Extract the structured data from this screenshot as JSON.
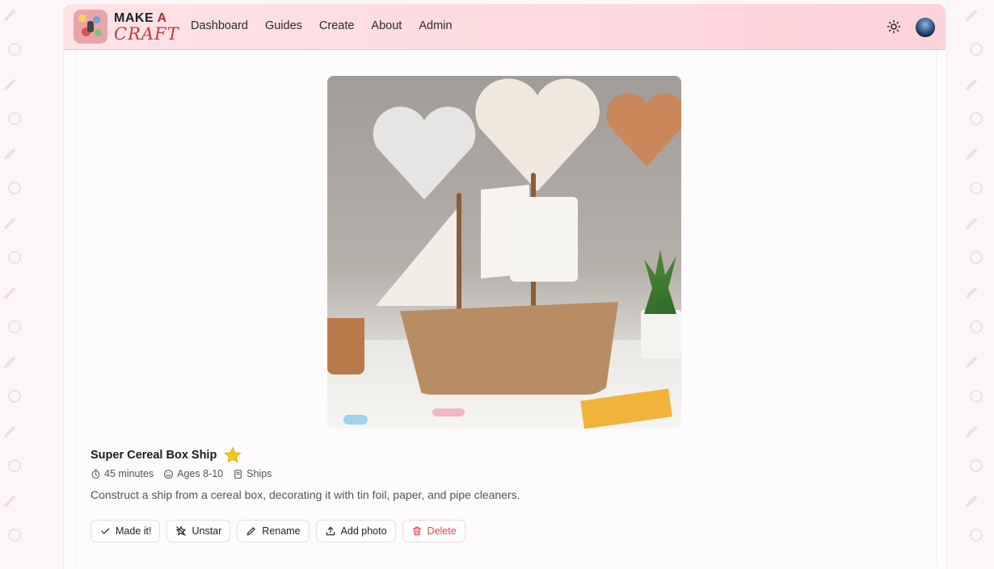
{
  "brand": {
    "line1_a": "MAKE",
    "line1_b": "A",
    "line2": "CRAFT"
  },
  "nav": [
    "Dashboard",
    "Guides",
    "Create",
    "About",
    "Admin"
  ],
  "icons": {
    "theme": "sun-icon",
    "avatar": "user-avatar",
    "star": "star-icon",
    "time": "timer-icon",
    "age": "smile-icon",
    "category": "book-icon"
  },
  "craft": {
    "title": "Super Cereal Box Ship",
    "starred": true,
    "duration": "45 minutes",
    "ages": "Ages 8-10",
    "category": "Ships",
    "description": "Construct a ship from a cereal box, decorating it with tin foil, paper, and pipe cleaners."
  },
  "actions": {
    "made_it": "Made it!",
    "unstar": "Unstar",
    "rename": "Rename",
    "add_photo": "Add photo",
    "delete": "Delete"
  },
  "colors": {
    "accent": "#c43a3f",
    "header_bg": "#fdd8de",
    "star": "#f5c518",
    "danger": "#e0464b"
  }
}
